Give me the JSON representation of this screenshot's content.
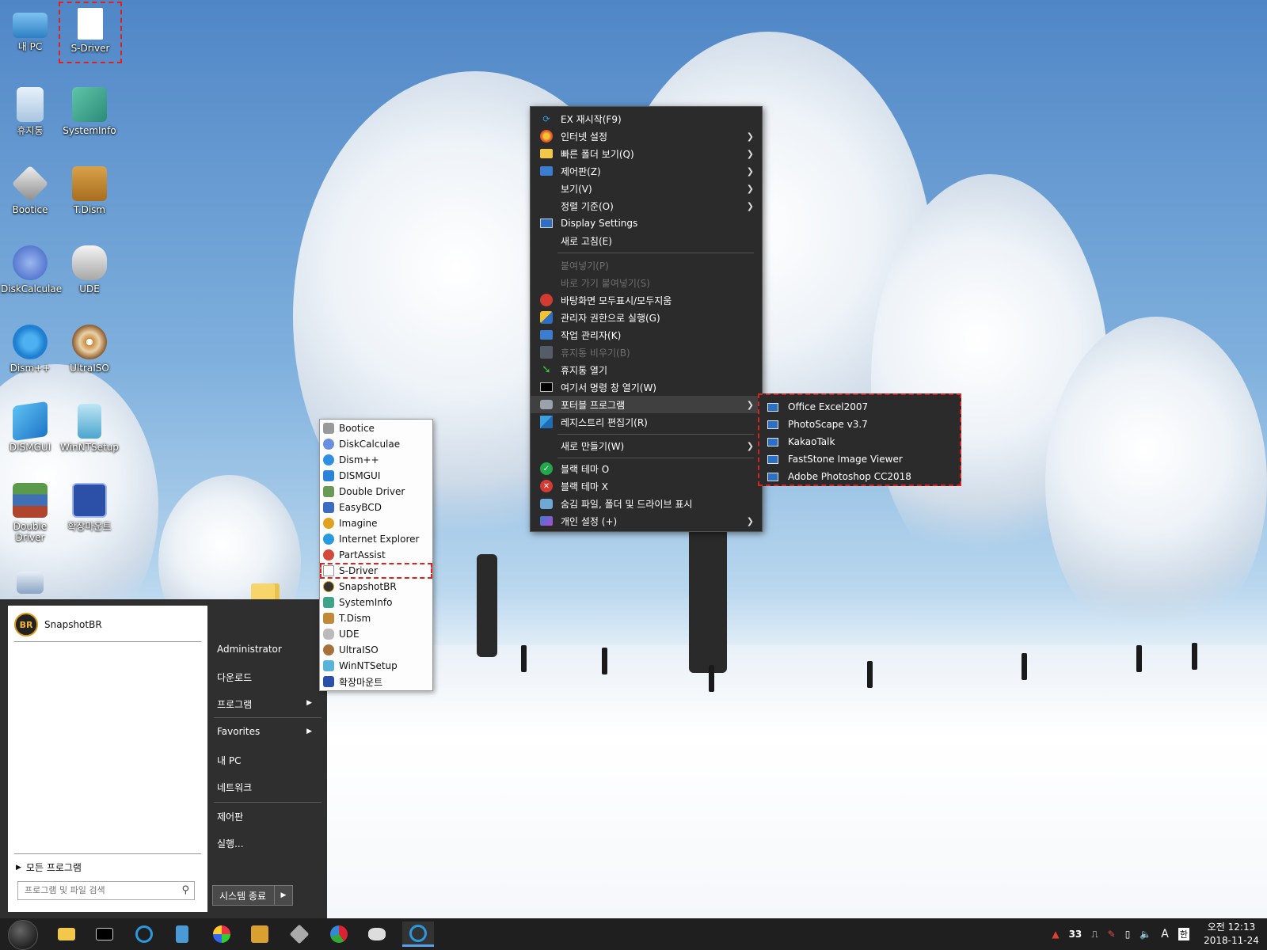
{
  "desktop": {
    "icons": [
      {
        "label": "내 PC",
        "icon": "computer-icon"
      },
      {
        "label": "S-Driver",
        "icon": "document-icon"
      },
      {
        "label": "휴지통",
        "icon": "recycle-bin-icon"
      },
      {
        "label": "SystemInfo",
        "icon": "systeminfo-icon"
      },
      {
        "label": "Bootice",
        "icon": "bootice-icon"
      },
      {
        "label": "T.Dism",
        "icon": "tdism-icon"
      },
      {
        "label": "DiskCalculae",
        "icon": "disk-calculator-icon"
      },
      {
        "label": "UDE",
        "icon": "ude-icon"
      },
      {
        "label": "Dism++",
        "icon": "gears-icon"
      },
      {
        "label": "UltraISO",
        "icon": "disc-icon"
      },
      {
        "label": "DISMGUI",
        "icon": "windows-logo-icon"
      },
      {
        "label": "WinNTSetup",
        "icon": "winntsetup-icon"
      },
      {
        "label": "Double Driver",
        "icon": "books-icon"
      },
      {
        "label": "확장마운트",
        "icon": "expand-icon"
      }
    ]
  },
  "start_menu": {
    "user": {
      "avatar_text": "BR",
      "name": "SnapshotBR"
    },
    "all_programs": "모든 프로그램",
    "search": {
      "placeholder": "프로그램 및 파일 검색"
    },
    "right_items": {
      "administrator": "Administrator",
      "downloads": "다운로드",
      "programs": "프로그램",
      "favorites": "Favorites",
      "my_pc": "내 PC",
      "network": "네트워크",
      "control_panel": "제어판",
      "run": "실행..."
    },
    "shutdown": "시스템 종료"
  },
  "program_menu": {
    "items": [
      "Bootice",
      "DiskCalculae",
      "Dism++",
      "DISMGUI",
      "Double Driver",
      "EasyBCD",
      "Imagine",
      "Internet Explorer",
      "PartAssist",
      "S-Driver",
      "SnapshotBR",
      "SystemInfo",
      "T.Dism",
      "UDE",
      "UltraISO",
      "WinNTSetup",
      "확장마운트"
    ],
    "highlighted": "S-Driver"
  },
  "context_menu": {
    "items": {
      "ex_restart": "EX 재시작(F9)",
      "internet": "인터넷 설정",
      "quick_folder": "빠른 폴더 보기(Q)",
      "control_panel": "제어판(Z)",
      "view": "보기(V)",
      "sort": "정렬 기준(O)",
      "display": "Display Settings",
      "refresh": "새로 고침(E)",
      "paste": "붙여넣기(P)",
      "paste_shortcut": "바로 가기 붙여넣기(S)",
      "desktop_toggle": "바탕화면 모두표시/모두지움",
      "run_admin": "관리자 권한으로 실행(G)",
      "task_manager": "작업 관리자(K)",
      "empty_bin": "휴지통 비우기(B)",
      "open_bin": "휴지통 열기",
      "cmd_here": "여기서 명령 창 열기(W)",
      "portable": "포터블 프로그램",
      "regedit": "레지스트리 편집기(R)",
      "new": "새로 만들기(W)",
      "black_on": "블랙 테마 O",
      "black_off": "블랙 테마 X",
      "hidden_files": "숨김 파일, 폴더 및 드라이브 표시",
      "personalize": "개인 설정 (+)"
    }
  },
  "portable_submenu": {
    "items": [
      "Office Excel2007",
      "PhotoScape v3.7",
      "KakaoTalk",
      "FastStone Image Viewer",
      "Adobe Photoshop CC2018"
    ]
  },
  "taskbar": {
    "apps": [
      "file-explorer-icon",
      "command-prompt-icon",
      "internet-explorer-icon",
      "notepad-icon",
      "paint-icon",
      "rufus-icon",
      "bootice-icon",
      "partassist-icon",
      "ude-icon",
      "internet-explorer-icon"
    ],
    "tray": {
      "number": "33",
      "ime": "A",
      "lang": "한"
    },
    "clock": {
      "time": "오전 12:13",
      "date": "2018-11-24"
    }
  },
  "colors": {
    "highlight_dash": "#e0201c",
    "menu_dark": "#2b2b2b",
    "taskbar": "#1f1f1f"
  }
}
